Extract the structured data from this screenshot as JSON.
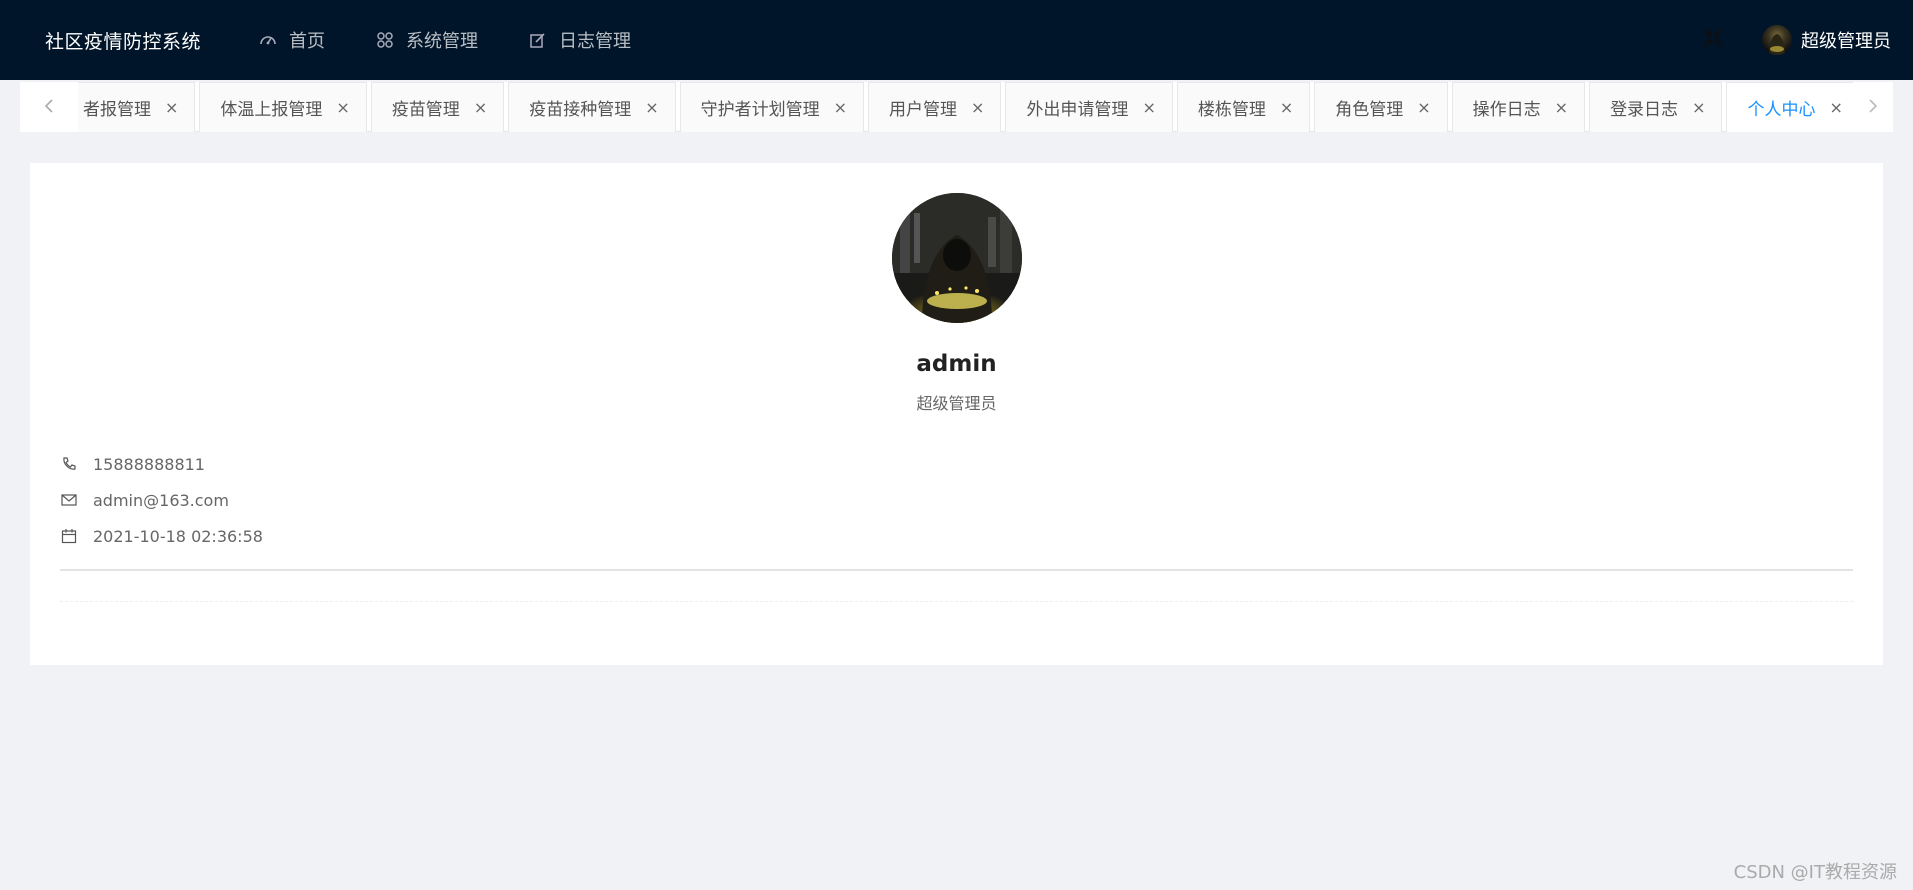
{
  "header": {
    "app_title": "社区疫情防控系统",
    "nav": [
      {
        "label": "首页",
        "icon": "dashboard-icon"
      },
      {
        "label": "系统管理",
        "icon": "appstore-icon"
      },
      {
        "label": "日志管理",
        "icon": "edit-icon"
      }
    ],
    "user_name": "超级管理员",
    "fullscreen_icon": "fullscreen-exit-icon"
  },
  "tabs": {
    "items": [
      {
        "label": "者报管理"
      },
      {
        "label": "体温上报管理"
      },
      {
        "label": "疫苗管理"
      },
      {
        "label": "疫苗接种管理"
      },
      {
        "label": "守护者计划管理"
      },
      {
        "label": "用户管理"
      },
      {
        "label": "外出申请管理"
      },
      {
        "label": "楼栋管理"
      },
      {
        "label": "角色管理"
      },
      {
        "label": "操作日志"
      },
      {
        "label": "登录日志"
      },
      {
        "label": "个人中心"
      }
    ],
    "active": "个人中心",
    "close_glyph": "×"
  },
  "profile": {
    "name": "admin",
    "role": "超级管理员",
    "phone": "15888888811",
    "email": "admin@163.com",
    "created_at": "2021-10-18 02:36:58"
  },
  "watermark": "CSDN @IT教程资源",
  "colors": {
    "header_bg": "#001529",
    "accent": "#1890ff",
    "page_bg": "#f0f2f5"
  }
}
